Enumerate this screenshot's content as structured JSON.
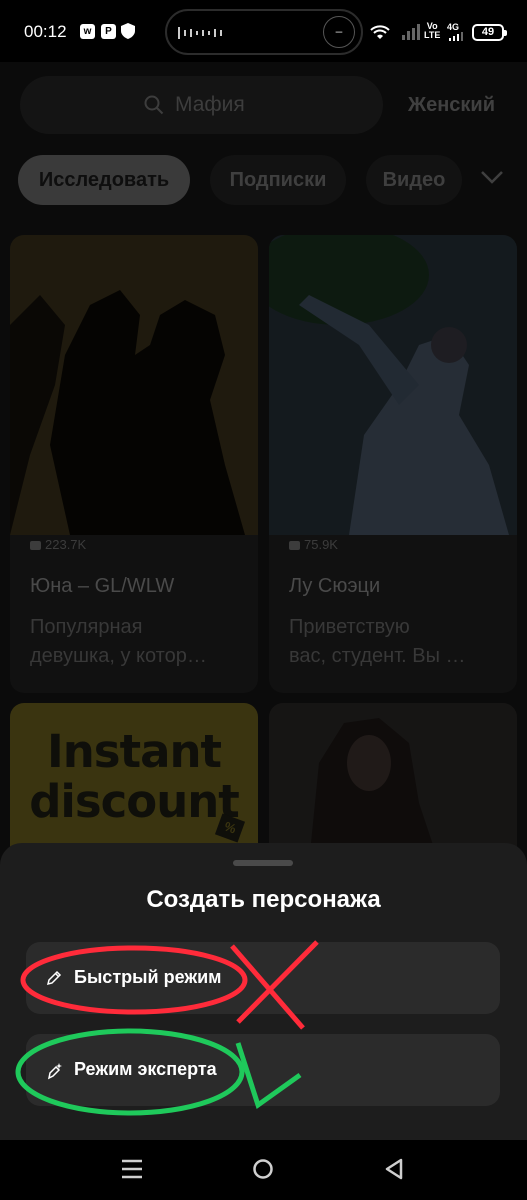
{
  "status_bar": {
    "time": "00:12",
    "volte": "Vo\nLTE",
    "network": "4G",
    "battery": "49",
    "island_icon": "–"
  },
  "search": {
    "placeholder": "Мафия",
    "icon": "search-icon"
  },
  "gender_filter": "Женский",
  "tabs": [
    {
      "label": "Исследовать",
      "active": true
    },
    {
      "label": "Подписки",
      "active": false
    },
    {
      "label": "Видео",
      "active": false
    }
  ],
  "cards": [
    {
      "stats": "223.7K",
      "title": "Юна – GL/WLW",
      "desc_line1": "Популярная",
      "desc_line2": "девушка, у котор…"
    },
    {
      "stats": "75.9K",
      "title": "Лу Сюэци",
      "desc_line1": "Приветствую",
      "desc_line2": "вас, студент. Вы …"
    }
  ],
  "promo": {
    "line1": "Instant",
    "line2": "discount",
    "tag": "%"
  },
  "sheet": {
    "title": "Создать персонажа",
    "options": [
      {
        "label": "Быстрый режим",
        "icon": "pencil-icon"
      },
      {
        "label": "Режим эксперта",
        "icon": "magic-pen-icon"
      }
    ]
  },
  "colors": {
    "sheet_bg": "#1d1d1d",
    "option_bg": "#2b2b2b",
    "annotation_red": "#ff2b3a",
    "annotation_green": "#1fc95b",
    "promo_yellow": "#3a3410"
  }
}
